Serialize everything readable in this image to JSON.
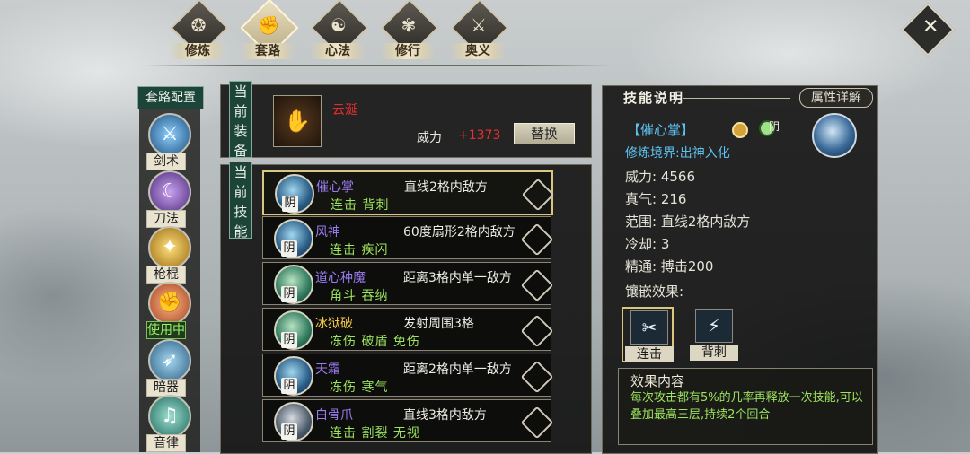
{
  "nav": {
    "tabs": [
      {
        "label": "修炼",
        "icon": "spiral-icon"
      },
      {
        "label": "套路",
        "icon": "fist-icon"
      },
      {
        "label": "心法",
        "icon": "yinyang-icon"
      },
      {
        "label": "修行",
        "icon": "scroll-icon"
      },
      {
        "label": "奥义",
        "icon": "sword-icon"
      }
    ],
    "active_index": 1
  },
  "left": {
    "title": "套路配置",
    "categories": [
      {
        "label": "剑术",
        "icon": "sword-icon"
      },
      {
        "label": "刀法",
        "icon": "blade-icon"
      },
      {
        "label": "枪棍",
        "icon": "spear-icon"
      },
      {
        "label": "使用中",
        "icon": "fist-icon"
      },
      {
        "label": "暗器",
        "icon": "dart-icon"
      },
      {
        "label": "音律",
        "icon": "music-icon"
      }
    ],
    "active_index": 3
  },
  "equipment": {
    "section_label": "当前装备",
    "name": "云涎",
    "power_label": "威力",
    "power_value": "+1373",
    "replace_label": "替换"
  },
  "skills": {
    "section_label": "当前技能",
    "items": [
      {
        "name": "催心掌",
        "name_color": "#9a7cf2",
        "range": "直线2格内敌方",
        "attrs": "连击 背刺",
        "tag": "阴"
      },
      {
        "name": "风神",
        "name_color": "#9a7cf2",
        "range": "60度扇形2格内敌方",
        "attrs": "连击 疾闪",
        "tag": "阴"
      },
      {
        "name": "道心种魔",
        "name_color": "#9a7cf2",
        "range": "距离3格内单一敌方",
        "attrs": "角斗 吞纳",
        "tag": "阴"
      },
      {
        "name": "冰狱破",
        "name_color": "#f2c84b",
        "range": "发射周围3格",
        "attrs": "冻伤 破盾 免伤",
        "tag": "阴"
      },
      {
        "name": "天霜",
        "name_color": "#9a7cf2",
        "range": "距离2格内单一敌方",
        "attrs": "冻伤 寒气",
        "tag": "阴"
      },
      {
        "name": "白骨爪",
        "name_color": "#9a7cf2",
        "range": "直线3格内敌方",
        "attrs": "连击 割裂 无视",
        "tag": "阴"
      }
    ]
  },
  "detail": {
    "title": "技能说明",
    "attr_button": "属性详解",
    "skill_name": "【催心掌】",
    "element_label": "阴",
    "realm": "修炼境界:出神入化",
    "stats": [
      {
        "label": "威力:",
        "value": "4566"
      },
      {
        "label": "真气:",
        "value": "216"
      },
      {
        "label": "范围:",
        "value": "直线2格内敌方"
      },
      {
        "label": "冷却:",
        "value": "3"
      },
      {
        "label": "精通:",
        "value": "搏击200"
      }
    ],
    "inlay_label": "镶嵌效果:",
    "gems": [
      {
        "label": "连击",
        "icon": "combo-strike-icon"
      },
      {
        "label": "背刺",
        "icon": "backstab-icon"
      }
    ],
    "effect_title": "效果内容",
    "effect_text": "每次攻击都有5%的几率再释放一次技能,可以叠加最高三层,持续2个回合"
  }
}
